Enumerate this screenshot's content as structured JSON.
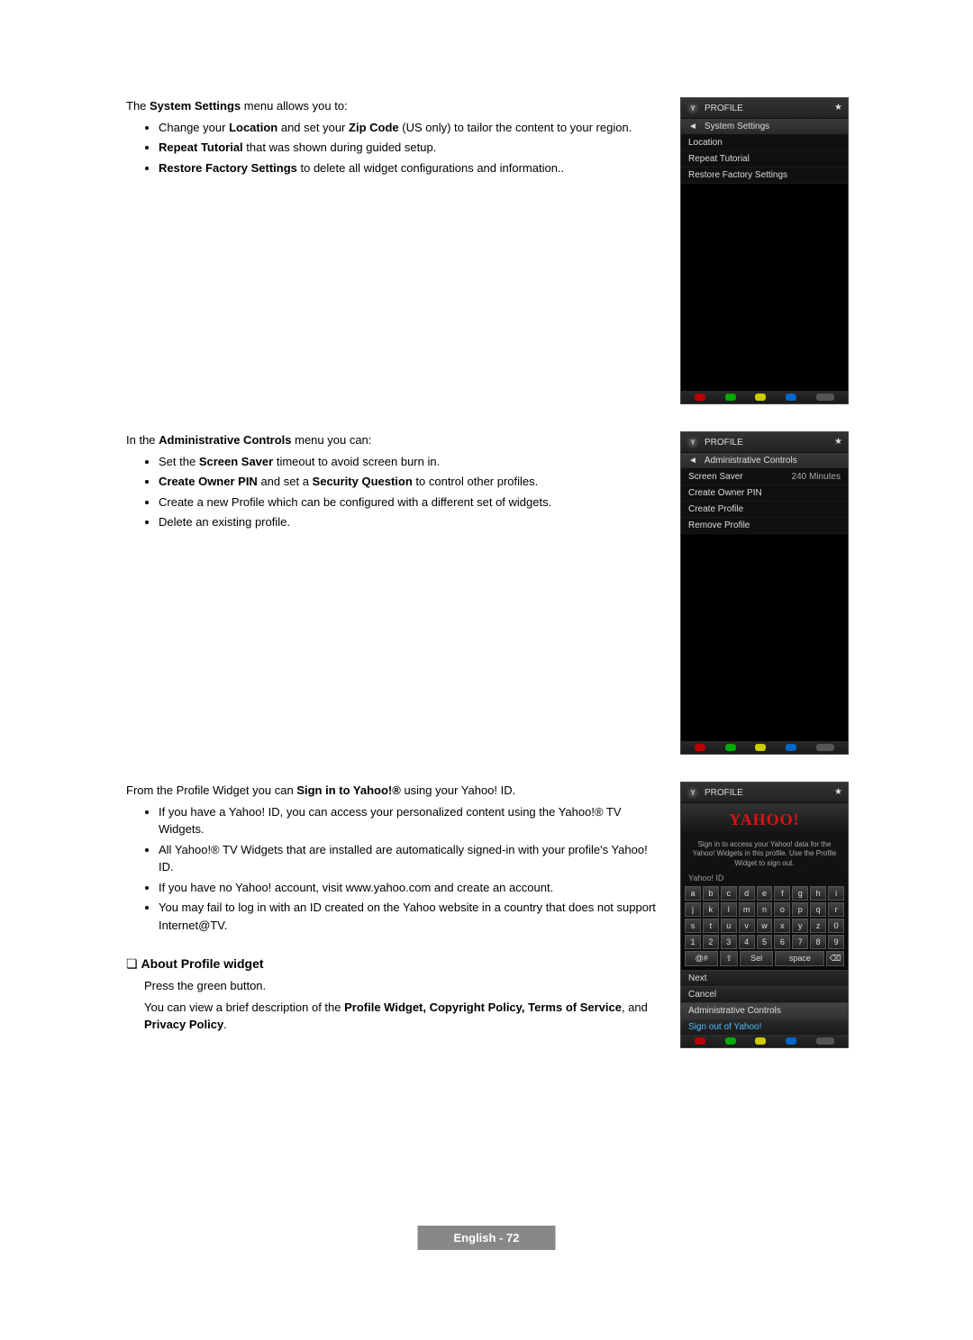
{
  "section1": {
    "intro_pre": "The ",
    "intro_bold": "System Settings",
    "intro_post": " menu allows you to:",
    "b1_pre": "Change your ",
    "b1_b1": "Location",
    "b1_mid": " and set your ",
    "b1_b2": "Zip Code",
    "b1_post": " (US only) to tailor the content to your region.",
    "b2_b": "Repeat Tutorial",
    "b2_post": " that was shown during guided setup.",
    "b3_b": "Restore Factory Settings",
    "b3_post": " to delete all widget configurations and information.."
  },
  "section2": {
    "intro_pre": "In the ",
    "intro_bold": "Administrative Controls",
    "intro_post": " menu you can:",
    "b1_pre": "Set the ",
    "b1_b": "Screen Saver",
    "b1_post": " timeout to avoid screen burn in.",
    "b2_b1": "Create Owner PIN",
    "b2_mid": " and set a ",
    "b2_b2": "Security Question",
    "b2_post": " to control other profiles.",
    "b3": "Create a new Profile which can be configured with a different set of widgets.",
    "b4": "Delete an existing profile."
  },
  "section3": {
    "intro_pre": "From the Profile Widget you can ",
    "intro_bold": "Sign in to Yahoo!®",
    "intro_post": " using your Yahoo! ID.",
    "b1": "If you have a Yahoo! ID, you can access your personalized content using the Yahoo!® TV Widgets.",
    "b2": "All Yahoo!® TV Widgets that are installed are automatically signed-in with your profile's Yahoo! ID.",
    "b3": "If you have no Yahoo! account, visit www.yahoo.com and create an account.",
    "b4": "You may fail to log in with an ID created on the Yahoo website in a country that does not support Internet@TV."
  },
  "about": {
    "heading": "About Profile widget",
    "line1": "Press the green button.",
    "line2_pre": "You can view a brief description of the ",
    "line2_b": "Profile Widget, Copyright Policy, Terms of Service",
    "line2_mid": ", and ",
    "line2_b2": "Privacy Policy",
    "line2_post": "."
  },
  "widget1": {
    "title": "PROFILE",
    "subtitle": "System Settings",
    "items": [
      "Location",
      "Repeat Tutorial",
      "Restore Factory Settings"
    ]
  },
  "widget2": {
    "title": "PROFILE",
    "subtitle": "Administrative Controls",
    "items": [
      {
        "label": "Screen Saver",
        "val": "240 Minutes"
      },
      {
        "label": "Create Owner PIN",
        "val": ""
      },
      {
        "label": "Create Profile",
        "val": ""
      },
      {
        "label": "Remove Profile",
        "val": ""
      }
    ]
  },
  "widget3": {
    "title": "PROFILE",
    "logo": "YAHOO!",
    "signin": "Sign in to access your Yahoo! data for the Yahoo! Widgets in this profile. Use the Profile Widget to sign out.",
    "id_label": "Yahoo! ID",
    "rows": [
      [
        "a",
        "b",
        "c",
        "d",
        "e",
        "f",
        "g",
        "h",
        "i"
      ],
      [
        "j",
        "k",
        "l",
        "m",
        "n",
        "o",
        "p",
        "q",
        "r"
      ],
      [
        "s",
        "t",
        "u",
        "v",
        "w",
        "x",
        "y",
        "z",
        "0"
      ],
      [
        "1",
        "2",
        "3",
        "4",
        "5",
        "6",
        "7",
        "8",
        "9"
      ]
    ],
    "sp_row": [
      "@#",
      "⇧",
      "Sel",
      "space",
      "⌫"
    ],
    "next": "Next",
    "cancel": "Cancel",
    "admin": "Administrative Controls",
    "signout": "Sign out of Yahoo!"
  },
  "footer": "English - 72"
}
